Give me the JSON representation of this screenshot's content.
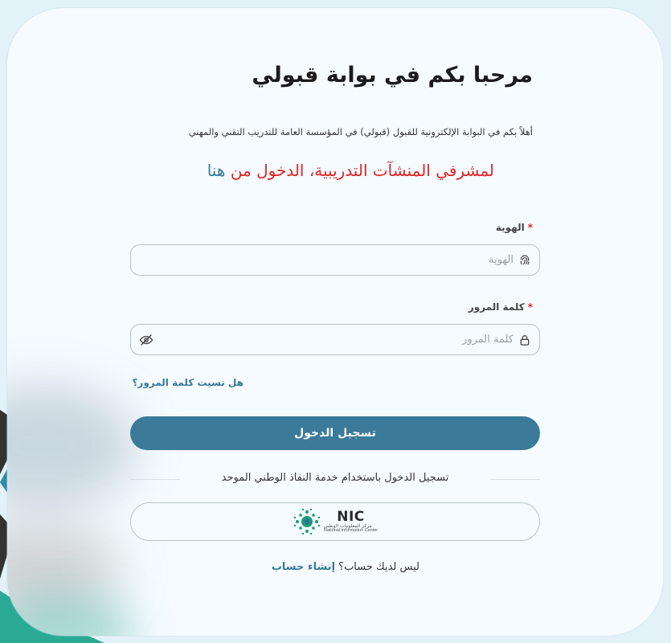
{
  "header": {
    "title": "مرحبا بكم في بوابة قبولي",
    "subtitle": "أهلاً بكم في البوابة الإلكترونية للقبول (قبولي) في المؤسسة العامة للتدريب التقني والمهني"
  },
  "supervisor": {
    "text": "لمشرفي المنشآت التدريبية، الدخول من",
    "link": "هنا"
  },
  "form": {
    "id_label": "الهوية",
    "id_placeholder": "الهوية",
    "password_label": "كلمة المرور",
    "password_placeholder": "كلمة المرور",
    "required_mark": "*",
    "forgot_password": "هل نسيت كلمة المرور؟",
    "login_button": "تسجيل الدخول"
  },
  "nafath": {
    "divider_text": "تسجيل الدخول باستخدام خدمة النفاذ الوطني الموحد",
    "logo_title": "NIC",
    "logo_ar": "مركز المعلومات الوطني",
    "logo_en": "National Information Center"
  },
  "signup": {
    "prompt": "ليس لديك حساب؟",
    "link": "إنشاء حساب"
  },
  "colors": {
    "primary": "#3b7a99",
    "required": "#e02424",
    "card_bg": "#f5fbfe",
    "page_bg": "#e3f1f9"
  }
}
